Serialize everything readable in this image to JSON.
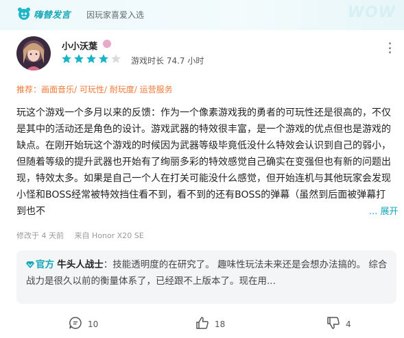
{
  "banner": {
    "badge_text": "嗨替发言",
    "subtitle": "因玩家喜爱入选",
    "deco_text": "WOW"
  },
  "user": {
    "name": "小小沃葉",
    "rating": 4,
    "rating_max": 5,
    "playtime": "游戏时长 74.7 小时"
  },
  "recommend": "推荐：画面音乐/ 可玩性/ 耐玩度/ 运营服务",
  "review": {
    "text": "玩这个游戏一个多月以来的反馈：作为一个像素游戏我的勇者的可玩性还是很高的，不仅是其中的活动还是角色的设计。游戏武器的特效很丰富，是一个游戏的优点但也是游戏的缺点。在刚开始玩这个游戏的时候因为武器等级毕竟低没什么特效会认识到自己的弱小，但随着等级的提升武器也开始有了绚丽多彩的特效感觉自己确实在变强但也有新的问题出现，特效太多。如果是自己一个人在打关可能没什么感觉，但开始连机与其他玩家会发现小怪和BOSS经常被特效挡住看不到，看不到的还有BOSS的弹幕（虽然到后面被弹幕打到也不",
    "expand_label": "... 展开"
  },
  "meta": {
    "modified": "修改于 4 天前",
    "device": "来自 Honor X20 SE"
  },
  "reply": {
    "official_label": "官方",
    "author": "牛头人战士",
    "text": "：技能透明度的在研究了。 趣味性玩法未来还是会想办法搞的。 综合战力是很久以前的衡量体系了，已经跟不上版本了。现在用..."
  },
  "actions": {
    "comments": "10",
    "likes": "18",
    "dislikes": "4"
  },
  "colors": {
    "accent": "#14a7b8",
    "recommend": "#f07a3a",
    "star": "#18b4c6"
  }
}
